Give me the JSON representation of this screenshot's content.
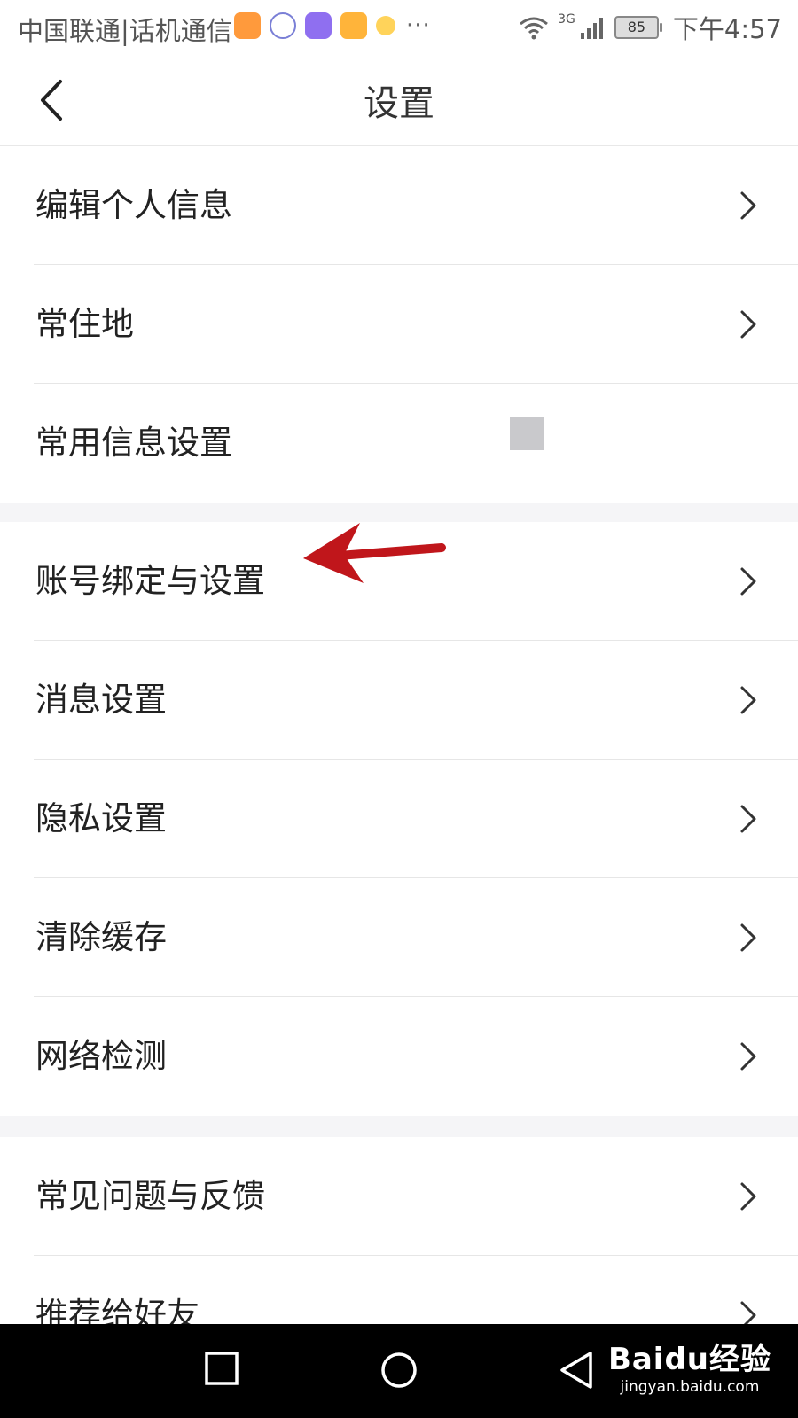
{
  "status_bar": {
    "carrier": "中国联通|话机通信",
    "more": "···",
    "network": "3G",
    "battery": "85",
    "time": "下午4:57"
  },
  "header": {
    "title": "设置"
  },
  "groups": [
    {
      "items": [
        {
          "label": "编辑个人信息"
        },
        {
          "label": "常住地"
        },
        {
          "label": "常用信息设置"
        }
      ]
    },
    {
      "items": [
        {
          "label": "账号绑定与设置"
        },
        {
          "label": "消息设置"
        },
        {
          "label": "隐私设置"
        },
        {
          "label": "清除缓存"
        },
        {
          "label": "网络检测"
        }
      ]
    },
    {
      "items": [
        {
          "label": "常见问题与反馈"
        },
        {
          "label": "推荐给好友"
        }
      ]
    }
  ],
  "annotation": {
    "color": "#c0161b",
    "points_to": "账号绑定与设置"
  },
  "watermark": {
    "brand": "Baidu经验",
    "url": "jingyan.baidu.com"
  },
  "icons": [
    "back-icon",
    "chevron-right-icon",
    "wifi-icon",
    "signal-icon",
    "battery-icon",
    "recent-apps-icon",
    "home-icon",
    "back-nav-icon"
  ]
}
